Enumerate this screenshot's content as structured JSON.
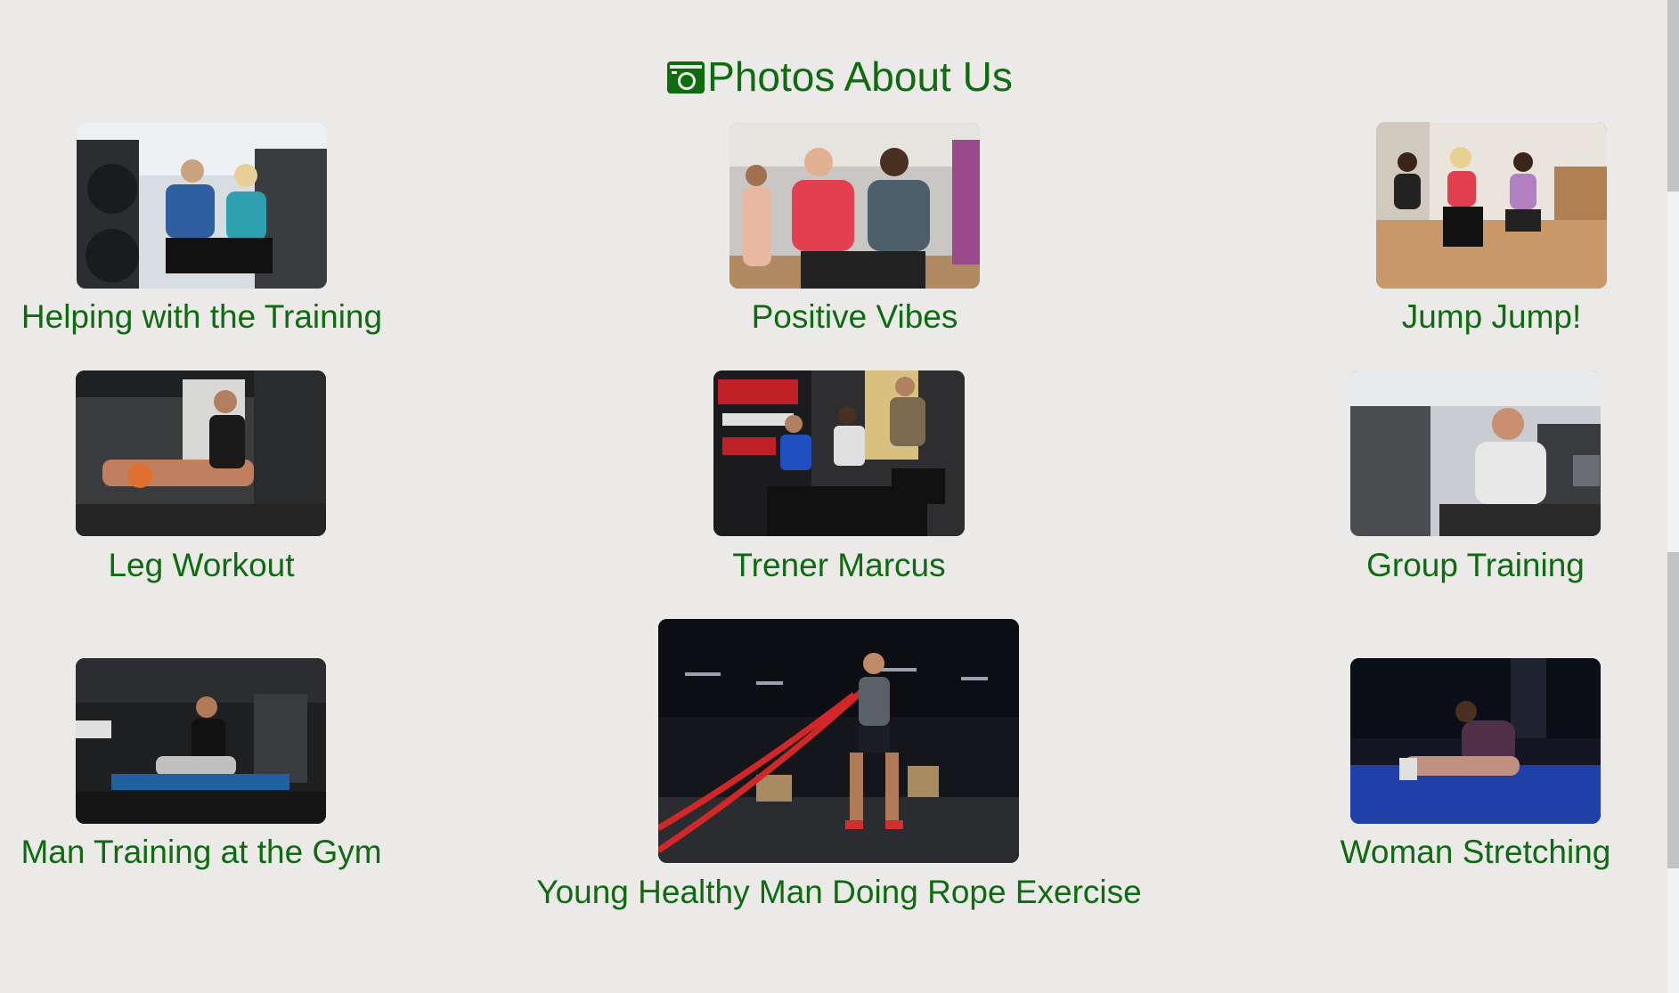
{
  "section": {
    "title": "Photos About Us",
    "icon": "camera-icon"
  },
  "colors": {
    "accent": "#0f6b10",
    "background": "#ebeae9"
  },
  "gallery": [
    {
      "caption": "Helping with the Training",
      "image": "trainer-helping-client-photo"
    },
    {
      "caption": "Positive Vibes",
      "image": "women-dancing-photo"
    },
    {
      "caption": "Jump Jump!",
      "image": "group-jumping-photo"
    },
    {
      "caption": "Leg Workout",
      "image": "leg-workout-photo"
    },
    {
      "caption": "Trener Marcus",
      "image": "spin-bike-class-photo"
    },
    {
      "caption": "Group Training",
      "image": "man-smiling-gym-photo"
    },
    {
      "caption": "Man Training at the Gym",
      "image": "man-rowing-machine-photo"
    },
    {
      "caption": "Young Healthy Man Doing Rope Exercise",
      "image": "battle-rope-photo"
    },
    {
      "caption": "Woman Stretching",
      "image": "woman-stretching-photo"
    }
  ]
}
